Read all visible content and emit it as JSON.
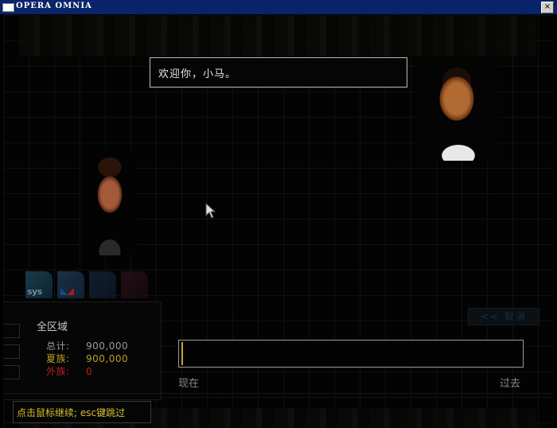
{
  "window": {
    "title": "OPERA OMNIA",
    "close_glyph": "×"
  },
  "dialog": {
    "text": "欢迎你，小马。"
  },
  "portraits": {
    "right": "speaker-portrait",
    "left": "listener-portrait"
  },
  "tabs": [
    {
      "label": "sys"
    },
    {
      "label": ""
    },
    {
      "label": ""
    },
    {
      "label": ""
    }
  ],
  "region": {
    "title": "全区域",
    "stats": [
      {
        "label": "总计:",
        "value": "900,000",
        "color": "#9a9a9a"
      },
      {
        "label": "夏族:",
        "value": "900,000",
        "color": "#b8a020"
      },
      {
        "label": "外族:",
        "value": "0",
        "color": "#b82020"
      }
    ]
  },
  "cancel": {
    "label": "<< 取消"
  },
  "timeline": {
    "now_label": "现在",
    "past_label": "过去"
  },
  "hint": {
    "text": "点击鼠标继续; esc键跳过"
  }
}
